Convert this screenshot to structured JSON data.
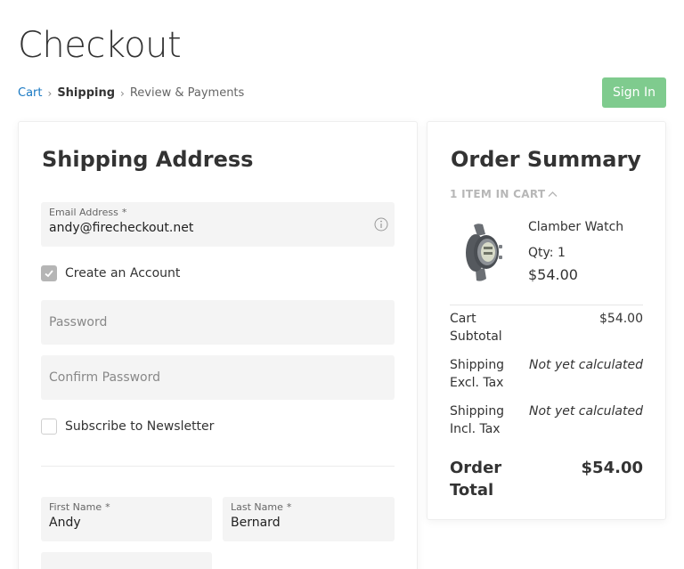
{
  "page": {
    "title": "Checkout"
  },
  "breadcrumb": {
    "cart": "Cart",
    "separator": "›",
    "shipping": "Shipping",
    "review": "Review & Payments"
  },
  "header": {
    "signin_label": "Sign In",
    "signin_color": "#7fcb8e"
  },
  "shipping": {
    "heading": "Shipping Address",
    "email": {
      "label": "Email Address",
      "required": "*",
      "value": "andy@firecheckout.net",
      "icon": "info-icon"
    },
    "create_account": {
      "label": "Create an Account",
      "checked": true
    },
    "password": {
      "placeholder": "Password"
    },
    "confirm_password": {
      "placeholder": "Confirm Password"
    },
    "newsletter": {
      "label": "Subscribe to Newsletter",
      "checked": false
    },
    "first_name": {
      "label": "First Name",
      "required": "*",
      "value": "Andy"
    },
    "last_name": {
      "label": "Last Name",
      "required": "*",
      "value": "Bernard"
    }
  },
  "summary": {
    "heading": "Order Summary",
    "items_toggle": "1 ITEM IN CART",
    "toggle_icon": "chevron-up-icon",
    "product": {
      "name": "Clamber Watch",
      "qty": "Qty: 1",
      "price": "$54.00"
    },
    "totals": [
      {
        "label": "Cart Subtotal",
        "value": "$54.00"
      },
      {
        "label": "Shipping Excl. Tax",
        "value": "Not yet calculated"
      },
      {
        "label": "Shipping Incl. Tax",
        "value": "Not yet calculated"
      },
      {
        "label": "Order Total",
        "value": "$54.00"
      }
    ]
  }
}
